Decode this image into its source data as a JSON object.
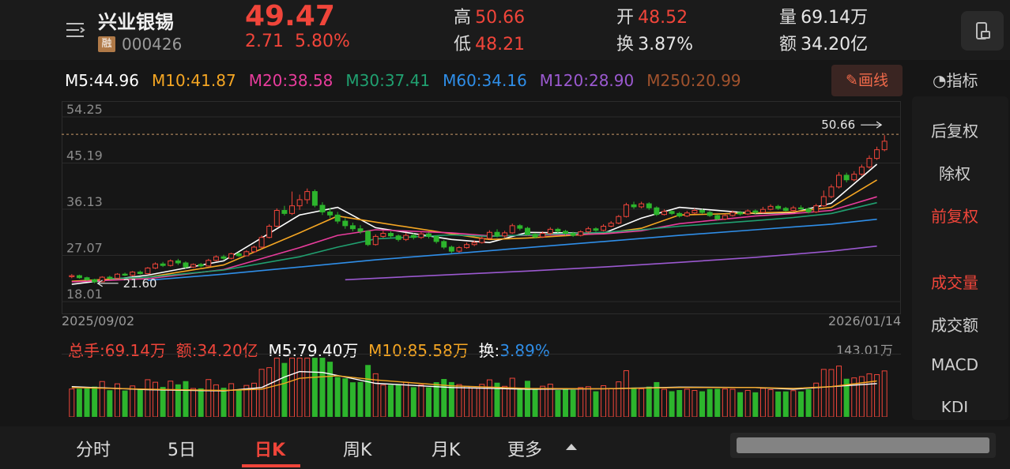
{
  "header": {
    "stock_name": "兴业银锡",
    "rong_badge": "融",
    "code": "000426",
    "price": "49.47",
    "change": "2.71",
    "change_pct": "5.80%",
    "high_label": "高",
    "high_value": "50.66",
    "low_label": "低",
    "low_value": "48.21",
    "open_label": "开",
    "open_value": "48.52",
    "turnover_label": "换",
    "turnover_value": "3.87%",
    "volume_label": "量",
    "volume_value": "69.14万",
    "amount_label": "额",
    "amount_value": "34.20亿"
  },
  "ma_legend": [
    {
      "label": "M5:44.96",
      "color": "#ffffff"
    },
    {
      "label": "M10:41.87",
      "color": "#f5a623"
    },
    {
      "label": "M20:38.58",
      "color": "#e83c9c"
    },
    {
      "label": "M30:37.41",
      "color": "#20a070"
    },
    {
      "label": "M60:34.16",
      "color": "#2f8ee8"
    },
    {
      "label": "M120:28.90",
      "color": "#9b59d0"
    },
    {
      "label": "M250:20.99",
      "color": "#a0522d"
    }
  ],
  "draw_button": "画线",
  "indicator_label": "指标",
  "side_menu": [
    {
      "label": "后复权",
      "active": false
    },
    {
      "label": "除权",
      "active": false
    },
    {
      "label": "前复权",
      "active": true
    },
    {
      "label": "成交量",
      "active": true
    },
    {
      "label": "成交额",
      "active": false
    },
    {
      "label": "MACD",
      "active": false
    },
    {
      "label": "KDJ",
      "active": false
    }
  ],
  "dates": {
    "start": "2025/09/02",
    "end": "2026/01/14"
  },
  "volume_legend": {
    "total": "总手:69.14万",
    "amount": "额:34.20亿",
    "m5": "M5:79.40万",
    "m10": "M10:85.58万",
    "turnover_label": "换:",
    "turnover_value": "3.89%",
    "max": "143.01万"
  },
  "colors": {
    "up": "#f0453a",
    "down": "#2db52d",
    "m5": "#ffffff",
    "m10": "#f5a623",
    "m20": "#e83c9c",
    "m30": "#20a070",
    "m60": "#2f8ee8",
    "m120": "#9b59d0"
  },
  "bottom_tabs": [
    {
      "label": "分时",
      "active": false
    },
    {
      "label": "5日",
      "active": false
    },
    {
      "label": "日K",
      "active": true
    },
    {
      "label": "周K",
      "active": false
    },
    {
      "label": "月K",
      "active": false
    },
    {
      "label": "更多",
      "active": false
    }
  ],
  "chart_data": {
    "type": "candlestick",
    "y_ticks": [
      "54.25",
      "45.19",
      "36.13",
      "27.07",
      "18.01"
    ],
    "ylim": [
      18.01,
      54.25
    ],
    "high_marker": "50.66",
    "low_marker": "21.60",
    "candles": [
      [
        22.9,
        23.1,
        23.4,
        22.6
      ],
      [
        23.1,
        22.7,
        23.3,
        22.5
      ],
      [
        22.7,
        22.3,
        22.9,
        22.1
      ],
      [
        22.3,
        21.9,
        22.5,
        21.6
      ],
      [
        21.9,
        22.8,
        23.0,
        21.8
      ],
      [
        22.8,
        22.6,
        23.1,
        22.4
      ],
      [
        22.6,
        23.4,
        23.6,
        22.5
      ],
      [
        23.4,
        23.2,
        23.7,
        23.0
      ],
      [
        23.2,
        23.8,
        24.0,
        23.0
      ],
      [
        23.8,
        23.5,
        24.1,
        23.3
      ],
      [
        23.5,
        24.6,
        24.8,
        23.4
      ],
      [
        24.6,
        25.4,
        25.7,
        24.4
      ],
      [
        25.4,
        25.1,
        25.8,
        24.8
      ],
      [
        25.1,
        26.0,
        26.3,
        24.9
      ],
      [
        26.0,
        25.6,
        26.4,
        25.2
      ],
      [
        25.6,
        24.8,
        25.9,
        24.5
      ],
      [
        24.8,
        25.3,
        25.5,
        24.6
      ],
      [
        25.3,
        25.0,
        25.6,
        24.7
      ],
      [
        25.0,
        26.1,
        26.4,
        24.9
      ],
      [
        26.1,
        26.8,
        27.1,
        25.9
      ],
      [
        26.8,
        26.5,
        27.2,
        26.2
      ],
      [
        26.5,
        27.4,
        27.6,
        26.3
      ],
      [
        27.4,
        27.0,
        27.7,
        26.8
      ],
      [
        27.0,
        27.8,
        28.1,
        26.9
      ],
      [
        27.8,
        28.7,
        29.0,
        27.6
      ],
      [
        28.7,
        30.6,
        31.0,
        28.5
      ],
      [
        30.6,
        32.8,
        33.2,
        30.4
      ],
      [
        32.8,
        35.9,
        36.3,
        32.6
      ],
      [
        35.9,
        35.3,
        36.8,
        34.9
      ],
      [
        35.3,
        36.8,
        39.6,
        35.0
      ],
      [
        36.8,
        38.0,
        39.0,
        36.0
      ],
      [
        38.0,
        39.6,
        40.2,
        37.2
      ],
      [
        39.6,
        36.9,
        40.0,
        36.5
      ],
      [
        36.9,
        35.6,
        37.5,
        35.0
      ],
      [
        35.6,
        35.0,
        36.4,
        34.4
      ],
      [
        35.0,
        33.8,
        35.6,
        33.3
      ],
      [
        33.8,
        32.9,
        34.4,
        32.3
      ],
      [
        32.9,
        32.3,
        33.5,
        31.8
      ],
      [
        32.3,
        31.8,
        33.0,
        31.3
      ],
      [
        31.8,
        29.2,
        32.0,
        28.9
      ],
      [
        29.2,
        30.8,
        31.2,
        29.0
      ],
      [
        30.8,
        31.4,
        31.9,
        30.5
      ],
      [
        31.4,
        30.9,
        31.8,
        30.4
      ],
      [
        30.9,
        30.2,
        31.2,
        29.8
      ],
      [
        30.2,
        31.0,
        31.5,
        29.9
      ],
      [
        31.0,
        30.6,
        31.4,
        30.2
      ],
      [
        30.6,
        31.3,
        31.7,
        30.3
      ],
      [
        31.3,
        30.8,
        31.6,
        30.4
      ],
      [
        30.8,
        29.8,
        31.0,
        29.4
      ],
      [
        29.8,
        28.7,
        30.1,
        28.3
      ],
      [
        28.7,
        27.9,
        29.0,
        27.5
      ],
      [
        27.9,
        28.6,
        28.9,
        27.6
      ],
      [
        28.6,
        29.2,
        29.6,
        28.4
      ],
      [
        29.2,
        29.6,
        30.0,
        28.9
      ],
      [
        29.6,
        30.4,
        30.8,
        29.4
      ],
      [
        30.4,
        31.6,
        32.0,
        30.2
      ],
      [
        31.6,
        30.9,
        32.2,
        30.6
      ],
      [
        30.9,
        31.5,
        31.9,
        30.6
      ],
      [
        31.5,
        32.9,
        33.3,
        31.3
      ],
      [
        32.9,
        32.4,
        33.2,
        32.0
      ],
      [
        32.4,
        31.2,
        32.7,
        30.9
      ],
      [
        31.2,
        30.7,
        31.5,
        30.4
      ],
      [
        30.7,
        31.4,
        31.8,
        30.5
      ],
      [
        31.4,
        32.2,
        32.6,
        31.1
      ],
      [
        32.2,
        31.8,
        32.5,
        31.5
      ],
      [
        31.8,
        31.4,
        32.1,
        31.0
      ],
      [
        31.4,
        31.0,
        31.7,
        30.7
      ],
      [
        31.0,
        31.7,
        32.0,
        30.8
      ],
      [
        31.7,
        32.3,
        32.7,
        31.4
      ],
      [
        32.3,
        32.0,
        32.6,
        31.7
      ],
      [
        32.0,
        32.8,
        33.2,
        31.8
      ],
      [
        32.8,
        33.4,
        33.8,
        32.6
      ],
      [
        33.4,
        34.7,
        35.0,
        33.2
      ],
      [
        34.7,
        37.0,
        37.4,
        34.5
      ],
      [
        37.0,
        36.6,
        37.6,
        36.2
      ],
      [
        36.6,
        37.2,
        37.6,
        36.3
      ],
      [
        37.2,
        36.4,
        37.5,
        36.0
      ],
      [
        36.4,
        35.1,
        36.7,
        34.8
      ],
      [
        35.1,
        35.7,
        36.1,
        34.9
      ],
      [
        35.7,
        35.3,
        36.0,
        35.0
      ],
      [
        35.3,
        34.8,
        35.6,
        34.5
      ],
      [
        34.8,
        35.4,
        35.8,
        34.6
      ],
      [
        35.4,
        35.9,
        36.3,
        35.2
      ],
      [
        35.9,
        35.5,
        36.2,
        35.2
      ],
      [
        35.5,
        34.9,
        35.8,
        34.6
      ],
      [
        34.9,
        34.2,
        35.1,
        33.9
      ],
      [
        34.2,
        34.9,
        35.2,
        34.0
      ],
      [
        34.9,
        35.5,
        35.9,
        34.7
      ],
      [
        35.5,
        35.2,
        35.8,
        34.9
      ],
      [
        35.2,
        35.8,
        36.1,
        35.0
      ],
      [
        35.8,
        35.5,
        36.1,
        35.2
      ],
      [
        35.5,
        36.1,
        36.6,
        35.3
      ],
      [
        36.1,
        36.7,
        37.1,
        35.9
      ],
      [
        36.7,
        36.3,
        37.0,
        36.0
      ],
      [
        36.3,
        35.9,
        36.6,
        35.6
      ],
      [
        35.9,
        36.4,
        36.8,
        35.7
      ],
      [
        36.4,
        36.2,
        36.9,
        35.9
      ],
      [
        36.2,
        35.6,
        36.5,
        35.3
      ],
      [
        35.6,
        36.8,
        37.2,
        35.4
      ],
      [
        36.8,
        38.6,
        39.8,
        36.6
      ],
      [
        38.6,
        40.5,
        41.0,
        38.3
      ],
      [
        40.5,
        42.8,
        43.4,
        40.2
      ],
      [
        42.8,
        41.9,
        43.3,
        41.4
      ],
      [
        41.9,
        43.0,
        43.6,
        41.6
      ],
      [
        43.0,
        44.4,
        44.9,
        42.7
      ],
      [
        44.4,
        46.1,
        46.7,
        44.1
      ],
      [
        46.1,
        47.8,
        48.4,
        45.8
      ],
      [
        47.8,
        49.47,
        50.66,
        47.5
      ]
    ],
    "ma_series": {
      "m5": [
        [
          0,
          21.4
        ],
        [
          10,
          23.2
        ],
        [
          20,
          26.0
        ],
        [
          30,
          35.0
        ],
        [
          35,
          36.5
        ],
        [
          40,
          32.5
        ],
        [
          50,
          30.2
        ],
        [
          55,
          29.6
        ],
        [
          60,
          31.6
        ],
        [
          70,
          31.4
        ],
        [
          75,
          34.4
        ],
        [
          80,
          36.5
        ],
        [
          90,
          35.3
        ],
        [
          95,
          35.5
        ],
        [
          100,
          37.3
        ],
        [
          106,
          44.96
        ]
      ],
      "m10": [
        [
          0,
          22.0
        ],
        [
          10,
          22.8
        ],
        [
          20,
          25.2
        ],
        [
          30,
          31.5
        ],
        [
          35,
          34.8
        ],
        [
          40,
          33.6
        ],
        [
          50,
          31.3
        ],
        [
          55,
          30.2
        ],
        [
          60,
          30.5
        ],
        [
          70,
          31.4
        ],
        [
          75,
          32.4
        ],
        [
          80,
          35.0
        ],
        [
          90,
          35.4
        ],
        [
          95,
          35.6
        ],
        [
          100,
          36.5
        ],
        [
          106,
          41.87
        ]
      ],
      "m20": [
        [
          0,
          21.9
        ],
        [
          10,
          22.5
        ],
        [
          20,
          24.3
        ],
        [
          30,
          28.6
        ],
        [
          35,
          31.0
        ],
        [
          40,
          32.1
        ],
        [
          50,
          31.5
        ],
        [
          55,
          30.9
        ],
        [
          60,
          31.0
        ],
        [
          70,
          31.3
        ],
        [
          75,
          31.9
        ],
        [
          80,
          33.3
        ],
        [
          90,
          34.8
        ],
        [
          95,
          35.3
        ],
        [
          100,
          35.9
        ],
        [
          106,
          38.58
        ]
      ],
      "m30": [
        [
          5,
          22.5
        ],
        [
          10,
          22.8
        ],
        [
          20,
          24.2
        ],
        [
          30,
          26.8
        ],
        [
          35,
          28.7
        ],
        [
          40,
          30.3
        ],
        [
          50,
          31.1
        ],
        [
          55,
          30.8
        ],
        [
          60,
          31.1
        ],
        [
          70,
          31.6
        ],
        [
          75,
          32.1
        ],
        [
          80,
          32.8
        ],
        [
          90,
          33.9
        ],
        [
          95,
          34.5
        ],
        [
          100,
          35.3
        ],
        [
          106,
          37.41
        ]
      ],
      "m60": [
        [
          10,
          22.2
        ],
        [
          20,
          23.4
        ],
        [
          30,
          24.8
        ],
        [
          40,
          26.2
        ],
        [
          50,
          27.4
        ],
        [
          60,
          28.6
        ],
        [
          70,
          29.8
        ],
        [
          80,
          31.0
        ],
        [
          90,
          32.1
        ],
        [
          100,
          33.2
        ],
        [
          106,
          34.16
        ]
      ],
      "m120": [
        [
          36,
          22.3
        ],
        [
          50,
          23.3
        ],
        [
          60,
          24.0
        ],
        [
          70,
          24.8
        ],
        [
          80,
          25.7
        ],
        [
          90,
          26.7
        ],
        [
          100,
          27.9
        ],
        [
          106,
          28.9
        ]
      ]
    },
    "volume_ylim": [
      0,
      143.01
    ],
    "volume_ma": {
      "m5": [
        [
          0,
          72
        ],
        [
          10,
          65
        ],
        [
          20,
          62
        ],
        [
          25,
          70
        ],
        [
          28,
          95
        ],
        [
          30,
          108
        ],
        [
          33,
          106
        ],
        [
          36,
          95
        ],
        [
          40,
          80
        ],
        [
          50,
          70
        ],
        [
          60,
          66
        ],
        [
          70,
          67
        ],
        [
          80,
          71
        ],
        [
          90,
          70
        ],
        [
          95,
          66
        ],
        [
          100,
          72
        ],
        [
          106,
          79.4
        ]
      ],
      "m10": [
        [
          0,
          70
        ],
        [
          10,
          66
        ],
        [
          20,
          63
        ],
        [
          25,
          66
        ],
        [
          28,
          80
        ],
        [
          30,
          92
        ],
        [
          35,
          98
        ],
        [
          40,
          88
        ],
        [
          50,
          74
        ],
        [
          60,
          68
        ],
        [
          70,
          67
        ],
        [
          80,
          70
        ],
        [
          90,
          70
        ],
        [
          95,
          68
        ],
        [
          100,
          72
        ],
        [
          106,
          85.58
        ]
      ]
    }
  }
}
